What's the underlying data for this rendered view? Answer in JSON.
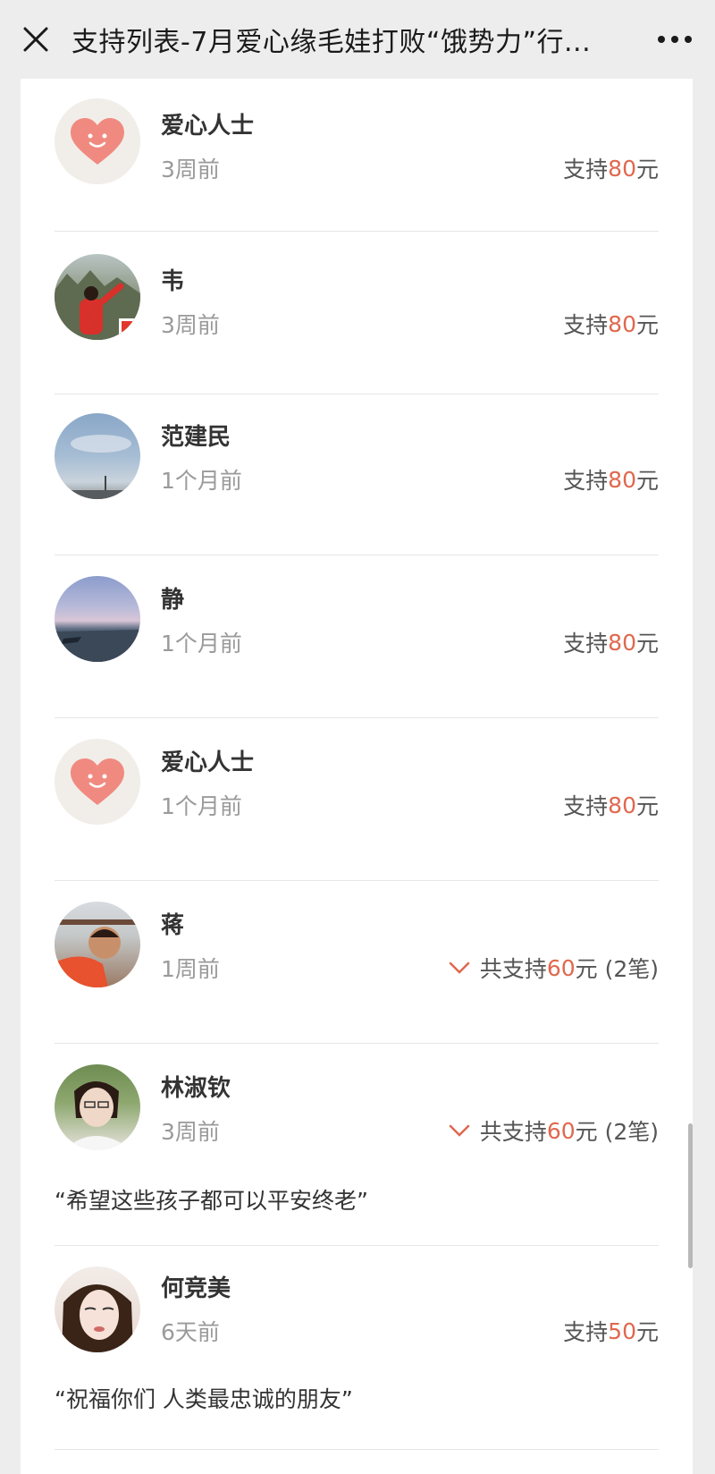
{
  "header": {
    "title": "支持列表-7月爱心缘毛娃打败“饿势力”行..."
  },
  "colors": {
    "accent": "#e0684e",
    "heart": "#f08a80"
  },
  "supporters": [
    {
      "name": "爱心人士",
      "time": "3周前",
      "prefix": "支持",
      "amount": "80",
      "suffix": "元",
      "avatar": "heart-avatar"
    },
    {
      "name": "韦",
      "time": "3周前",
      "prefix": "支持",
      "amount": "80",
      "suffix": "元",
      "avatar": "photo-avatar"
    },
    {
      "name": "范建民",
      "time": "1个月前",
      "prefix": "支持",
      "amount": "80",
      "suffix": "元",
      "avatar": "sky-avatar"
    },
    {
      "name": "静",
      "time": "1个月前",
      "prefix": "支持",
      "amount": "80",
      "suffix": "元",
      "avatar": "sea-avatar"
    },
    {
      "name": "爱心人士",
      "time": "1个月前",
      "prefix": "支持",
      "amount": "80",
      "suffix": "元",
      "avatar": "heart-avatar"
    },
    {
      "name": "蒋",
      "time": "1周前",
      "prefix": "共支持",
      "amount": "60",
      "suffix": "元 (2笔)",
      "avatar": "photo-avatar",
      "expandable": true
    },
    {
      "name": "林淑钦",
      "time": "3周前",
      "prefix": "共支持",
      "amount": "60",
      "suffix": "元 (2笔)",
      "avatar": "photo-avatar",
      "expandable": true,
      "message": "“希望这些孩子都可以平安终老”"
    },
    {
      "name": "何竞美",
      "time": "6天前",
      "prefix": "支持",
      "amount": "50",
      "suffix": "元",
      "avatar": "photo-avatar",
      "message": "“祝福你们 人类最忠诚的朋友”"
    }
  ]
}
